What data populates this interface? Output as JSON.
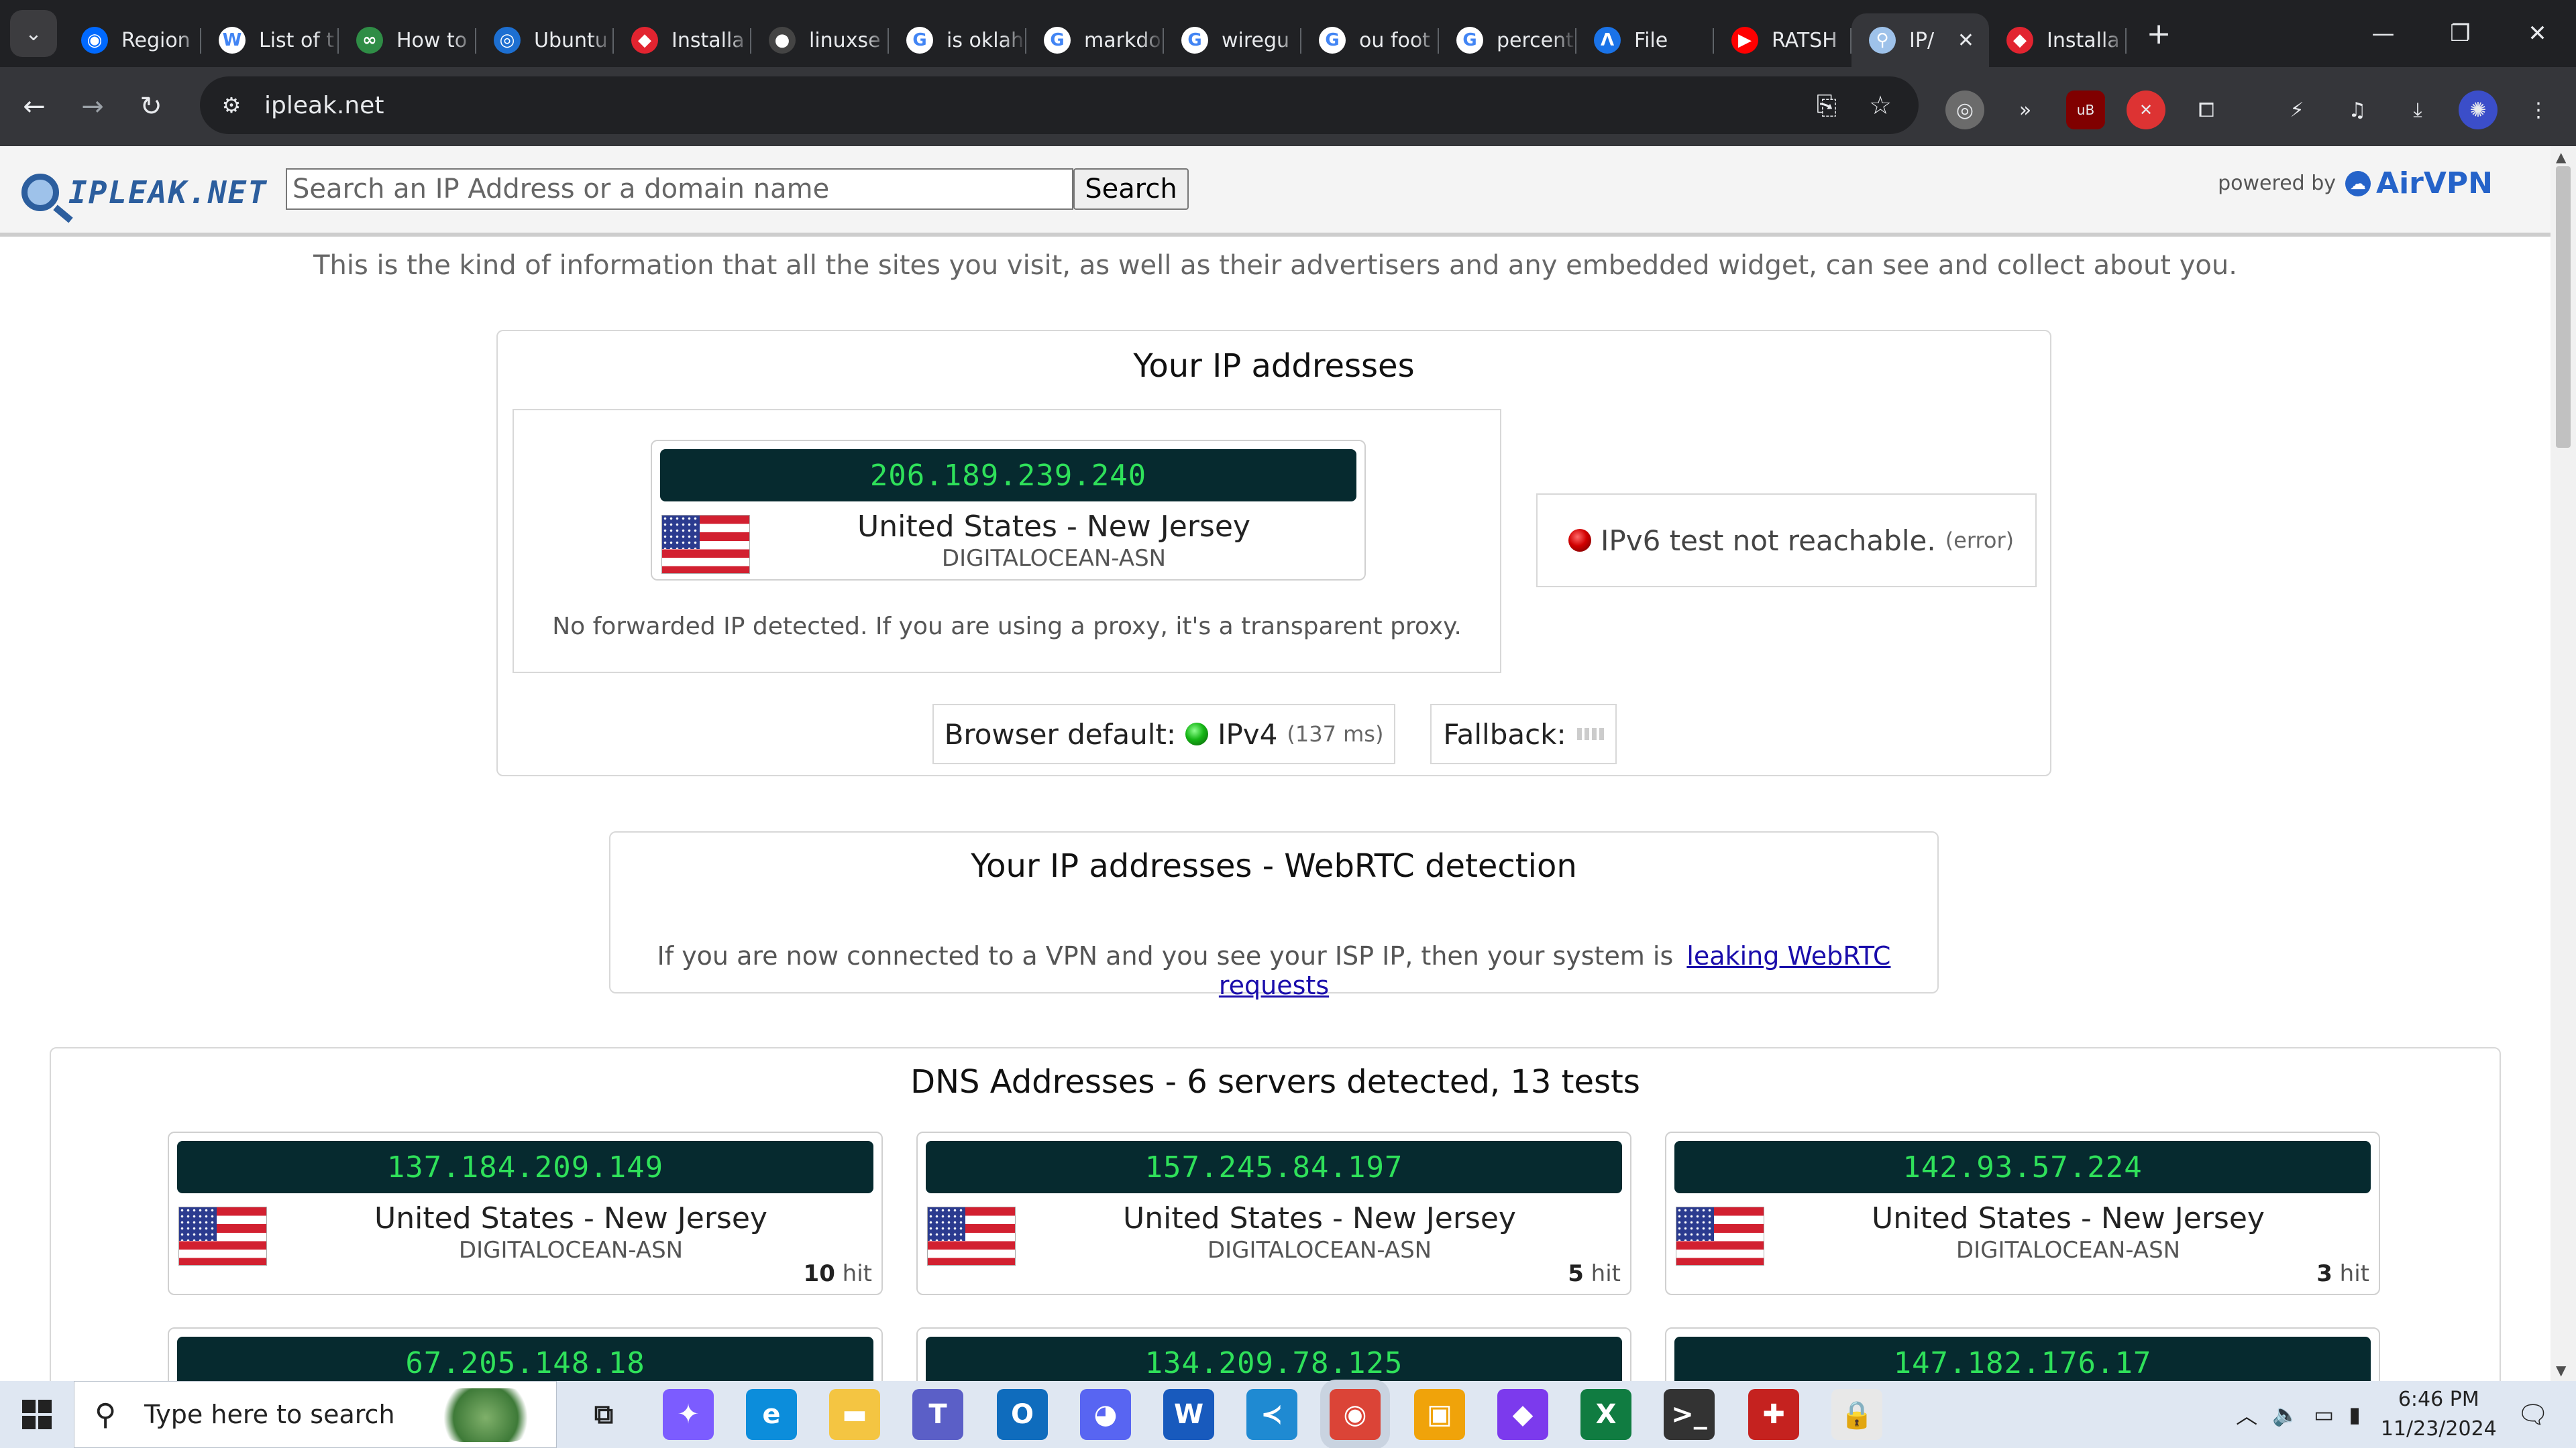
{
  "browser": {
    "tabs": [
      {
        "title": "Region",
        "icon": "digitalocean-icon",
        "color": "#0069ff",
        "glyph": "◉"
      },
      {
        "title": "List of t",
        "icon": "wikipedia-icon",
        "color": "#ffffff",
        "glyph": "W"
      },
      {
        "title": "How to",
        "icon": "geeksforgeeks-icon",
        "color": "#2f8d46",
        "glyph": "∞"
      },
      {
        "title": "Ubuntu",
        "icon": "ubuntu-icon",
        "color": "#1d6fd1",
        "glyph": "◎"
      },
      {
        "title": "Installa",
        "icon": "redhat-icon",
        "color": "#e22430",
        "glyph": "◆"
      },
      {
        "title": "linuxse",
        "icon": "github-icon",
        "color": "#444444",
        "glyph": "●"
      },
      {
        "title": "is oklah",
        "icon": "google-icon",
        "color": "#ffffff",
        "glyph": "G"
      },
      {
        "title": "markdo",
        "icon": "google-icon",
        "color": "#ffffff",
        "glyph": "G"
      },
      {
        "title": "wiregu",
        "icon": "google-icon",
        "color": "#ffffff",
        "glyph": "G"
      },
      {
        "title": "ou foot",
        "icon": "google-icon",
        "color": "#ffffff",
        "glyph": "G"
      },
      {
        "title": "percent",
        "icon": "google-icon",
        "color": "#ffffff",
        "glyph": "G"
      },
      {
        "title": "File",
        "icon": "file-app-icon",
        "color": "#1a73e8",
        "glyph": "Λ"
      },
      {
        "title": "RATSH",
        "icon": "youtube-icon",
        "color": "#ff0000",
        "glyph": "▶"
      },
      {
        "title": "IP/",
        "icon": "ipleak-icon",
        "color": "#9ec2ea",
        "glyph": "⚲",
        "active": true
      },
      {
        "title": "Installa",
        "icon": "redhat-icon",
        "color": "#e22430",
        "glyph": "◆"
      }
    ],
    "url": "ipleak.net"
  },
  "site": {
    "logo_text": "IPLEAK.NET",
    "search_placeholder": "Search an IP Address or a domain name",
    "search_button": "Search",
    "powered_by": "powered by",
    "airvpn": "AirVPN",
    "info_line": "This is the kind of information that all the sites you visit, as well as their advertisers and any embedded widget, can see and collect about you."
  },
  "ip_panel": {
    "title": "Your IP addresses",
    "ip": "206.189.239.240",
    "location": "United States - New Jersey",
    "asn": "DIGITALOCEAN-ASN",
    "forwarded_note": "No forwarded IP detected. If you are using a proxy, it's a transparent proxy.",
    "ipv6_status": "IPv6 test not reachable.",
    "ipv6_tag": "(error)",
    "browser_default_label": "Browser default:",
    "browser_default_proto": "IPv4",
    "browser_default_time": "(137 ms)",
    "fallback_label": "Fallback:"
  },
  "webrtc_panel": {
    "title": "Your IP addresses - WebRTC detection",
    "note": "If you are now connected to a VPN and you see your ISP IP, then your system is",
    "link": "leaking WebRTC requests"
  },
  "dns_panel": {
    "title": "DNS Addresses - 6 servers detected, 13 tests",
    "servers": [
      {
        "ip": "137.184.209.149",
        "location": "United States - New Jersey",
        "asn": "DIGITALOCEAN-ASN",
        "hits": "10",
        "hit_label": "hit"
      },
      {
        "ip": "157.245.84.197",
        "location": "United States - New Jersey",
        "asn": "DIGITALOCEAN-ASN",
        "hits": "5",
        "hit_label": "hit"
      },
      {
        "ip": "142.93.57.224",
        "location": "United States - New Jersey",
        "asn": "DIGITALOCEAN-ASN",
        "hits": "3",
        "hit_label": "hit"
      },
      {
        "ip": "67.205.148.18"
      },
      {
        "ip": "134.209.78.125"
      },
      {
        "ip": "147.182.176.17"
      }
    ]
  },
  "taskbar": {
    "search_text": "Type here to search",
    "time": "6:46 PM",
    "date": "11/23/2024",
    "apps": [
      {
        "name": "task-view-icon",
        "glyph": "⧉",
        "color": "#dfe7f2"
      },
      {
        "name": "copilot-icon",
        "glyph": "✦",
        "color": "#7c5cff"
      },
      {
        "name": "edge-icon",
        "glyph": "e",
        "color": "#0c8ddb"
      },
      {
        "name": "file-explorer-icon",
        "glyph": "▬",
        "color": "#f4c542"
      },
      {
        "name": "teams-icon",
        "glyph": "T",
        "color": "#5b5fc7"
      },
      {
        "name": "outlook-icon",
        "glyph": "O",
        "color": "#0f6cbd"
      },
      {
        "name": "discord-icon",
        "glyph": "◕",
        "color": "#5865f2"
      },
      {
        "name": "word-icon",
        "glyph": "W",
        "color": "#185abd"
      },
      {
        "name": "vscode-icon",
        "glyph": "≺",
        "color": "#1f8ad2"
      },
      {
        "name": "chrome-icon",
        "glyph": "◉",
        "color": "#db4437"
      },
      {
        "name": "terminal-app-icon",
        "glyph": "▣",
        "color": "#f0a30a"
      },
      {
        "name": "obsidian-icon",
        "glyph": "◆",
        "color": "#7c3aed"
      },
      {
        "name": "excel-icon",
        "glyph": "X",
        "color": "#107c41"
      },
      {
        "name": "cmd-icon",
        "glyph": ">_",
        "color": "#333333"
      },
      {
        "name": "security-app-icon",
        "glyph": "✚",
        "color": "#c5221f"
      },
      {
        "name": "vpn-app-icon",
        "glyph": "🔒",
        "color": "#e8e8e8"
      }
    ]
  }
}
